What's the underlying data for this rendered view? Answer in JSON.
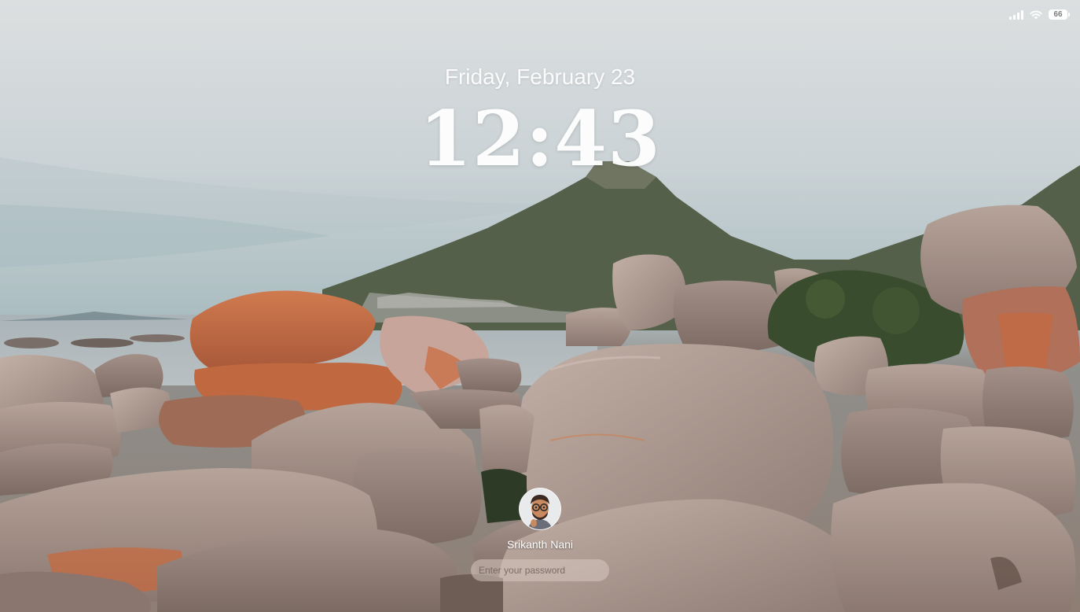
{
  "status_bar": {
    "battery_level": "66",
    "signal_icon": "cellular-signal-icon",
    "wifi_icon": "wifi-icon",
    "battery_icon": "battery-icon"
  },
  "lock_screen": {
    "date": "Friday, February 23",
    "time": "12:43"
  },
  "login": {
    "user_name": "Srikanth Nani",
    "avatar_icon": "memoji-avatar-icon",
    "password_placeholder": "Enter your password"
  },
  "colors": {
    "sky": "#d9dde0",
    "rock": "#8e7e74",
    "lichen": "#c9683b",
    "mountain": "#4a5640"
  }
}
